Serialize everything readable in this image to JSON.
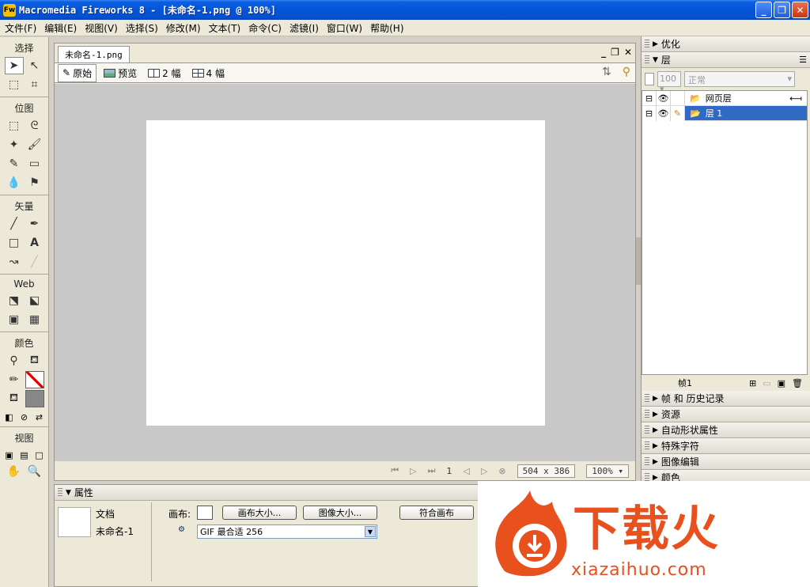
{
  "window": {
    "title": "Macromedia Fireworks 8 - [未命名-1.png @ 100%]",
    "app_icon": "fw8-icon"
  },
  "menu": [
    "文件(F)",
    "编辑(E)",
    "视图(V)",
    "选择(S)",
    "修改(M)",
    "文本(T)",
    "命令(C)",
    "滤镜(I)",
    "窗口(W)",
    "帮助(H)"
  ],
  "tools": {
    "select": "选择",
    "bitmap": "位图",
    "vector": "矢量",
    "web": "Web",
    "colors": "颜色",
    "view": "视图"
  },
  "document": {
    "tab": "未命名-1.png",
    "views": [
      "原始",
      "预览",
      "2 幅",
      "4 幅"
    ],
    "frame_number": "1",
    "canvas_size": "504 x 386",
    "zoom": "100%"
  },
  "panels": {
    "optimize": "优化",
    "layers": "层",
    "opacity": "100",
    "blend_mode": "正常",
    "layer_rows": [
      {
        "name": "网页层",
        "selected": false
      },
      {
        "name": "层 1",
        "selected": true
      }
    ],
    "frame_label": "帧1",
    "collapsed": [
      "帧 和 历史记录",
      "资源",
      "自动形状属性",
      "特殊字符",
      "图像编辑",
      "颜色"
    ]
  },
  "properties": {
    "title": "属性",
    "doc_label": "文档",
    "doc_name": "未命名-1",
    "canvas_label": "画布:",
    "canvas_size_btn": "画布大小...",
    "image_size_btn": "图像大小...",
    "fit_canvas_btn": "符合画布",
    "export_format": "GIF 最合适 256"
  },
  "watermark": {
    "text": "下载火",
    "url": "xiazaihuo.com"
  },
  "colors": {
    "titlebar": "#0554d6",
    "selection": "#316ac5",
    "watermark": "#e8501e"
  }
}
